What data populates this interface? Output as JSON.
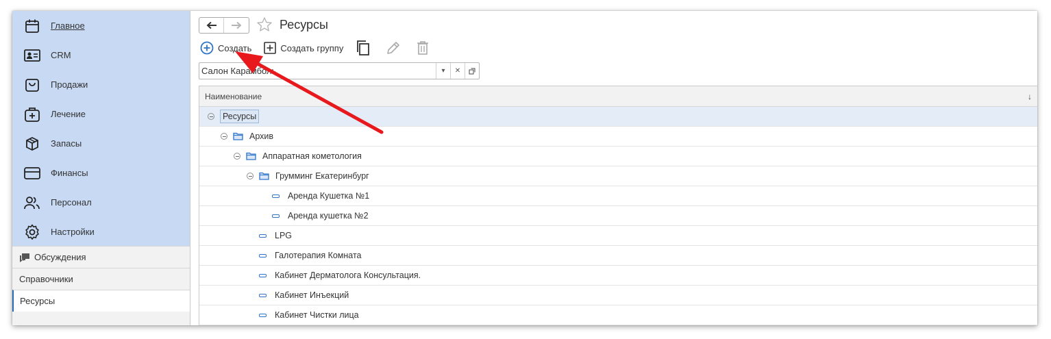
{
  "sidebar": {
    "nav": [
      {
        "label": "Главное",
        "icon": "calendar-icon"
      },
      {
        "label": "CRM",
        "icon": "contact-card-icon"
      },
      {
        "label": "Продажи",
        "icon": "shopping-bag-icon"
      },
      {
        "label": "Лечение",
        "icon": "medical-bag-icon"
      },
      {
        "label": "Запасы",
        "icon": "box-icon"
      },
      {
        "label": "Финансы",
        "icon": "credit-card-icon"
      },
      {
        "label": "Персонал",
        "icon": "people-icon"
      },
      {
        "label": "Настройки",
        "icon": "gear-icon"
      }
    ],
    "sections": {
      "discussions": "Обсуждения",
      "references": "Справочники",
      "resources": "Ресурсы"
    }
  },
  "header": {
    "title": "Ресурсы"
  },
  "toolbar": {
    "create_label": "Создать",
    "create_group_label": "Создать группу"
  },
  "filter": {
    "value": "Салон Карамболь"
  },
  "grid": {
    "column_header": "Наименование",
    "sort_indicator": "↓",
    "rows": [
      {
        "label": "Ресурсы",
        "type": "root"
      },
      {
        "label": "Архив",
        "type": "group"
      },
      {
        "label": "Аппаратная кометология",
        "type": "group"
      },
      {
        "label": "Грумминг Екатеринбург",
        "type": "group"
      },
      {
        "label": "Аренда Кушетка №1",
        "type": "item"
      },
      {
        "label": "Аренда кушетка №2",
        "type": "item"
      },
      {
        "label": "LPG",
        "type": "item"
      },
      {
        "label": "Галотерапия Комната",
        "type": "item"
      },
      {
        "label": "Кабинет Дерматолога Консультация.",
        "type": "item"
      },
      {
        "label": "Кабинет Инъекций",
        "type": "item"
      },
      {
        "label": "Кабинет Чистки лица",
        "type": "item"
      }
    ]
  },
  "colors": {
    "sidebar_nav_bg": "#c7d9f3",
    "accent_blue": "#2d74c9",
    "annotation_arrow": "#e8191d"
  }
}
